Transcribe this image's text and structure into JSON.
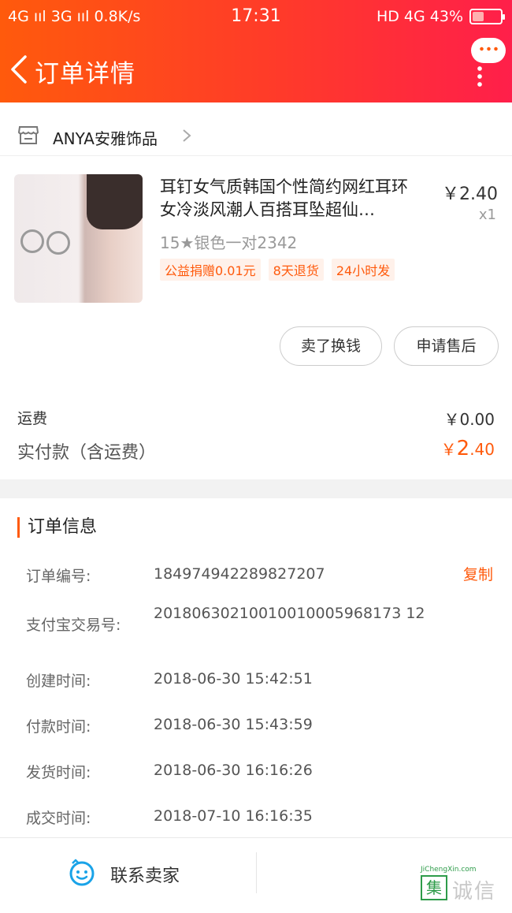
{
  "status_bar": {
    "left": "4G ııl 3G ııl 0.8K/s",
    "time": "17:31",
    "right": "HD 4G 43%"
  },
  "nav": {
    "title": "订单详情"
  },
  "shop": {
    "name": "ANYA安雅饰品"
  },
  "product": {
    "title": "耳钉女气质韩国个性简约网红耳环女冷淡风潮人百搭耳坠超仙…",
    "price": "￥2.40",
    "quantity": "x1",
    "sku": "15★银色一对2342",
    "tags": [
      "公益捐赠0.01元",
      "8天退货",
      "24小时发"
    ]
  },
  "actions": {
    "sell_label": "卖了换钱",
    "after_sale_label": "申请售后"
  },
  "summary": {
    "shipping_label": "运费",
    "shipping_value": "￥0.00",
    "paid_label": "实付款（含运费）",
    "paid_currency": "￥",
    "paid_integer": "2",
    "paid_decimal": ".40"
  },
  "order_info": {
    "title": "订单信息",
    "copy_label": "复制",
    "rows": [
      {
        "label": "订单编号:",
        "value": "184974942289827207"
      },
      {
        "label": "支付宝交易号:",
        "value": "20180630210010010005968173 12"
      },
      {
        "label": "创建时间:",
        "value": "2018-06-30 15:42:51"
      },
      {
        "label": "付款时间:",
        "value": "2018-06-30 15:43:59"
      },
      {
        "label": "发货时间:",
        "value": "2018-06-30 16:16:26"
      },
      {
        "label": "成交时间:",
        "value": "2018-07-10 16:16:35"
      }
    ]
  },
  "bottom": {
    "contact_label": "联系卖家"
  },
  "watermark": {
    "box": "集",
    "text": "诚信",
    "url": "JiChengXin.com"
  },
  "colors": {
    "accent": "#ff5a0c",
    "header_start": "#ff5a0c",
    "header_end": "#ff1f4a",
    "chat_icon": "#1aa3e8"
  }
}
